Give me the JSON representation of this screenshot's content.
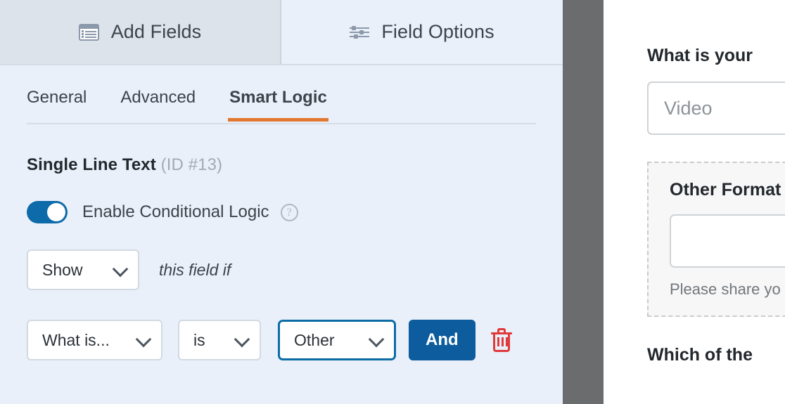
{
  "builder": {
    "primary_tabs": [
      {
        "label": "Add Fields",
        "icon": "list-window-icon",
        "active": false
      },
      {
        "label": "Field Options",
        "icon": "sliders-icon",
        "active": true
      }
    ],
    "sub_tabs": [
      {
        "label": "General",
        "active": false
      },
      {
        "label": "Advanced",
        "active": false
      },
      {
        "label": "Smart Logic",
        "active": true
      }
    ],
    "field": {
      "type_name": "Single Line Text",
      "id_label": "(ID #13)"
    },
    "conditional_logic": {
      "toggle_label": "Enable Conditional Logic",
      "toggle_on": true,
      "help_icon_label": "?",
      "action_select": "Show",
      "action_suffix_text": "this field if",
      "rule": {
        "field_select": "What is...",
        "operator_select": "is",
        "value_select": "Other",
        "and_button": "And",
        "delete_icon": "trash-icon"
      }
    },
    "accent_color": "#e27730",
    "toggle_color": "#0c6ba8",
    "button_color": "#0c5c9e",
    "delete_color": "#e03a3a"
  },
  "preview": {
    "question_label": "What is your",
    "format_select_value": "Video",
    "conditional_block": {
      "sub_label": "Other Format",
      "input_value": "",
      "description": "Please share yo"
    },
    "next_question_label": "Which of the"
  }
}
